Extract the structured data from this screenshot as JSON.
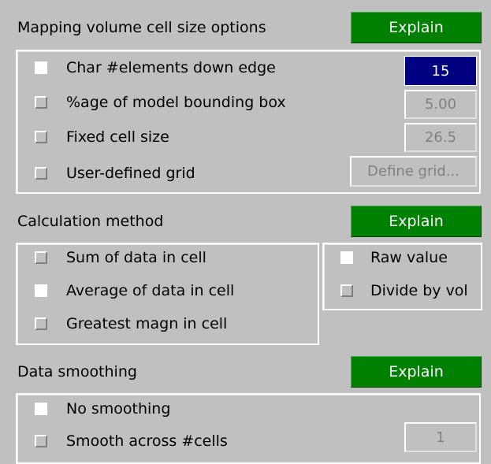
{
  "mapping": {
    "title": "Mapping volume cell size options",
    "explain_label": "Explain",
    "options": [
      {
        "label": "Char #elements down edge",
        "checked": true
      },
      {
        "label": "%age of model bounding box",
        "checked": false
      },
      {
        "label": "Fixed cell size",
        "checked": false
      },
      {
        "label": "User-defined grid",
        "checked": false
      }
    ],
    "char_elements_value": "15",
    "bbox_percent_value": "5.00",
    "fixed_cell_size_value": "26.5",
    "define_grid_label": "Define grid..."
  },
  "calculation": {
    "title": "Calculation method",
    "explain_label": "Explain",
    "methods": [
      {
        "label": "Sum of data in cell",
        "checked": false
      },
      {
        "label": "Average of data in cell",
        "checked": true
      },
      {
        "label": "Greatest magn in cell",
        "checked": false
      }
    ],
    "value_modes": [
      {
        "label": "Raw value",
        "checked": true
      },
      {
        "label": "Divide by vol",
        "checked": false
      }
    ]
  },
  "smoothing": {
    "title": "Data smoothing",
    "explain_label": "Explain",
    "options": [
      {
        "label": "No smoothing",
        "checked": true
      },
      {
        "label": "Smooth across #cells",
        "checked": false
      }
    ],
    "cells_value": "1"
  },
  "colors": {
    "background": "#c0c0c0",
    "explain_button": "#008000",
    "active_field": "#000080",
    "disabled_text": "#808080"
  }
}
